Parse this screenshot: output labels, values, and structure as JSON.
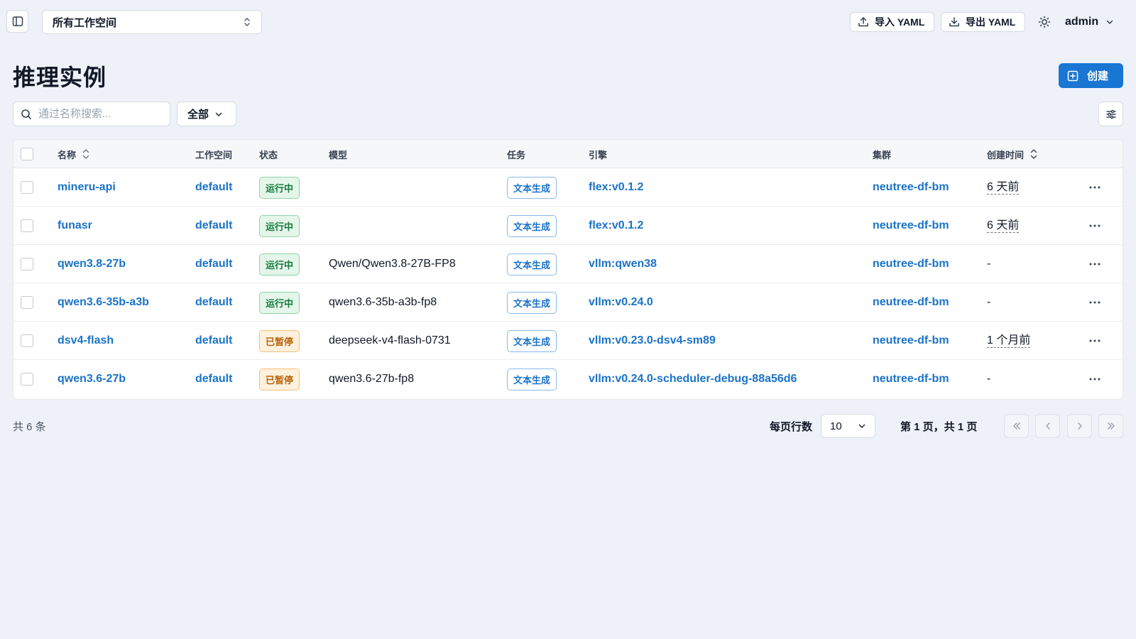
{
  "topbar": {
    "workspace_select": "所有工作空间",
    "import_label": "导入 YAML",
    "export_label": "导出 YAML",
    "user_name": "admin"
  },
  "page": {
    "title": "推理实例",
    "create_label": "创建"
  },
  "filters": {
    "search_placeholder": "通过名称搜索...",
    "status_value": "全部"
  },
  "table": {
    "headers": {
      "name": "名称",
      "workspace": "工作空间",
      "status": "状态",
      "model": "模型",
      "task": "任务",
      "engine": "引擎",
      "cluster": "集群",
      "created": "创建时间"
    },
    "rows": [
      {
        "name": "mineru-api",
        "workspace": "default",
        "status": "运行中",
        "status_kind": "running",
        "model": "",
        "task": "文本生成",
        "engine": "flex:v0.1.2",
        "cluster": "neutree-df-bm",
        "created": "6 天前"
      },
      {
        "name": "funasr",
        "workspace": "default",
        "status": "运行中",
        "status_kind": "running",
        "model": "",
        "task": "文本生成",
        "engine": "flex:v0.1.2",
        "cluster": "neutree-df-bm",
        "created": "6 天前"
      },
      {
        "name": "qwen3.8-27b",
        "workspace": "default",
        "status": "运行中",
        "status_kind": "running",
        "model": "Qwen/Qwen3.8-27B-FP8",
        "task": "文本生成",
        "engine": "vllm:qwen38",
        "cluster": "neutree-df-bm",
        "created": "-"
      },
      {
        "name": "qwen3.6-35b-a3b",
        "workspace": "default",
        "status": "运行中",
        "status_kind": "running",
        "model": "qwen3.6-35b-a3b-fp8",
        "task": "文本生成",
        "engine": "vllm:v0.24.0",
        "cluster": "neutree-df-bm",
        "created": "-"
      },
      {
        "name": "dsv4-flash",
        "workspace": "default",
        "status": "已暂停",
        "status_kind": "paused",
        "model": "deepseek-v4-flash-0731",
        "task": "文本生成",
        "engine": "vllm:v0.23.0-dsv4-sm89",
        "cluster": "neutree-df-bm",
        "created": "1 个月前"
      },
      {
        "name": "qwen3.6-27b",
        "workspace": "default",
        "status": "已暂停",
        "status_kind": "paused",
        "model": "qwen3.6-27b-fp8",
        "task": "文本生成",
        "engine": "vllm:v0.24.0-scheduler-debug-88a56d6",
        "cluster": "neutree-df-bm",
        "created": "-"
      }
    ]
  },
  "footer": {
    "total": "共 6 条",
    "rows_per_page_label": "每页行数",
    "rows_per_page": "10",
    "page_info": "第 1 页，共 1 页"
  },
  "colors": {
    "accent": "#1976d2",
    "link": "#1a73c8",
    "running": "#157a3c",
    "paused": "#b8630b",
    "background": "#eef1f7"
  },
  "icons": [
    "sidebar-toggle-icon",
    "chevron-up-down-icon",
    "upload-icon",
    "download-icon",
    "sun-icon",
    "chevron-down-icon",
    "plus-square-icon",
    "search-icon",
    "sliders-icon",
    "sort-icon",
    "more-horizontal-icon",
    "chevrons-left-icon",
    "chevron-left-icon",
    "chevron-right-icon",
    "chevrons-right-icon"
  ]
}
